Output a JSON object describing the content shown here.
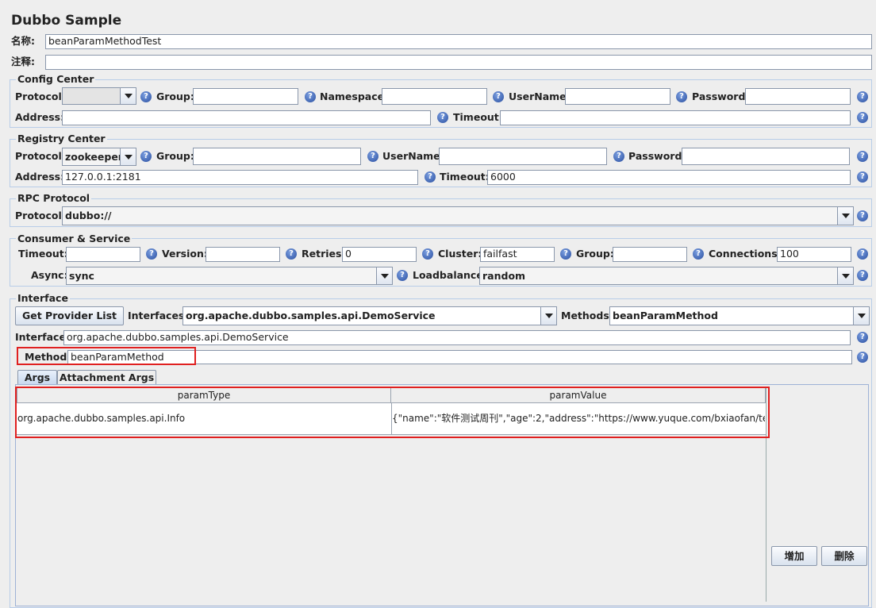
{
  "title": "Dubbo Sample",
  "name_label": "名称:",
  "name_value": "beanParamMethodTest",
  "comment_label": "注释:",
  "comment_value": "",
  "help_glyph": "?",
  "config": {
    "legend": "Config Center",
    "protocol_label": "Protocol:",
    "protocol": "",
    "group_label": "Group:",
    "group": "",
    "namespace_label": "Namespace:",
    "namespace": "",
    "username_label": "UserName:",
    "username": "",
    "password_label": "Password:",
    "password": "",
    "address_label": "Address:",
    "address": "",
    "timeout_label": "Timeout:",
    "timeout": ""
  },
  "registry": {
    "legend": "Registry Center",
    "protocol_label": "Protocol:",
    "protocol": "zookeeper",
    "group_label": "Group:",
    "group": "",
    "username_label": "UserName:",
    "username": "",
    "password_label": "Password:",
    "password": "",
    "address_label": "Address:",
    "address": "127.0.0.1:2181",
    "timeout_label": "Timeout:",
    "timeout": "6000"
  },
  "rpc": {
    "legend": "RPC Protocol",
    "protocol_label": "Protocol:",
    "protocol": "dubbo://"
  },
  "consumer": {
    "legend": "Consumer & Service",
    "timeout_label": "Timeout:",
    "timeout": "",
    "version_label": "Version:",
    "version": "",
    "retries_label": "Retries:",
    "retries": "0",
    "cluster_label": "Cluster:",
    "cluster": "failfast",
    "group_label": "Group:",
    "group": "",
    "connections_label": "Connections:",
    "connections": "100",
    "async_label": "Async:",
    "async": "sync",
    "loadbalance_label": "Loadbalance:",
    "loadbalance": "random"
  },
  "interface": {
    "legend": "Interface",
    "get_provider_button": "Get Provider List",
    "interfaces_label": "Interfaces:",
    "interfaces": "org.apache.dubbo.samples.api.DemoService",
    "methods_label": "Methods:",
    "methods": "beanParamMethod",
    "interface_label": "Interface:",
    "interface": "org.apache.dubbo.samples.api.DemoService",
    "method_label": "Method:",
    "method": "beanParamMethod"
  },
  "tabs": [
    {
      "label": "Args",
      "selected": true
    },
    {
      "label": "Attachment Args",
      "selected": false
    }
  ],
  "table": {
    "columns": [
      "paramType",
      "paramValue"
    ],
    "rows": [
      [
        "org.apache.dubbo.samples.api.Info",
        "{\"name\":\"软件测试周刊\",\"age\":2,\"address\":\"https://www.yuque.com/bxiaofan/te..."
      ]
    ]
  },
  "buttons": {
    "add": "增加",
    "delete": "删除"
  },
  "colors": {
    "highlight": "#e02020",
    "border": "#b8cde8"
  }
}
